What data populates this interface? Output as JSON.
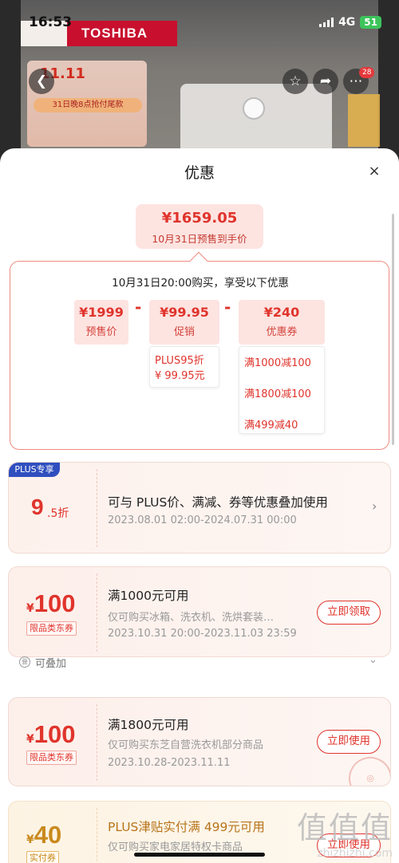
{
  "status_bar": {
    "time": "16:53",
    "network": "4G",
    "battery": "51"
  },
  "background": {
    "brand": "TOSHIBA",
    "promo_title": "11.11",
    "promo_sub": "31日晚8点抢付尾款",
    "notification_count": "28"
  },
  "sheet": {
    "title": "优惠",
    "close_label": "×",
    "final_price": "¥1659.05",
    "final_price_note": "10月31日预售到手价",
    "calc_header": "10月31日20:00购买，享受以下优惠",
    "items": [
      {
        "value": "¥1999",
        "label": "预售价"
      },
      {
        "value": "¥99.95",
        "label": "促销"
      },
      {
        "value": "¥240",
        "label": "优惠券"
      }
    ],
    "operator": "-",
    "promo_detail": [
      "PLUS95折",
      "¥ 99.95元"
    ],
    "coupon_detail": [
      "满1000减100",
      "满1800减100",
      "满499减40"
    ]
  },
  "plus_card": {
    "tag": "PLUS专享",
    "discount_big": "9",
    "discount_small": ".5折",
    "title": "可与 PLUS价、满减、券等优惠叠加使用",
    "date": "2023.08.01 02:00-2024.07.31 00:00"
  },
  "coupons": [
    {
      "currency": "¥",
      "amount": "100",
      "tag": "限品类东券",
      "title": "满1000元可用",
      "desc": "仅可购买冰箱、洗衣机、洗烘套装…",
      "date": "2023.10.31 20:00-2023.11.03 23:59",
      "button": "立即领取"
    },
    {
      "currency": "¥",
      "amount": "100",
      "tag": "限品类东券",
      "title": "满1800元可用",
      "desc": "仅可购买东芝自营洗衣机部分商品",
      "date": "2023.10.28-2023.11.11",
      "button": "立即使用"
    },
    {
      "currency": "¥",
      "amount": "40",
      "tag": "实付券",
      "title": "PLUS津贴实付满 499元可用",
      "desc": "仅可购买家电家居特权卡商品",
      "button": "立即使用"
    }
  ],
  "stack_label": "可叠加",
  "watermark": {
    "big": "值值值",
    "small": "zhizhizhi.com"
  },
  "colors": {
    "accent": "#e0342c",
    "light_pink": "#fde4e1",
    "plus_blue": "#2f4fbf"
  }
}
